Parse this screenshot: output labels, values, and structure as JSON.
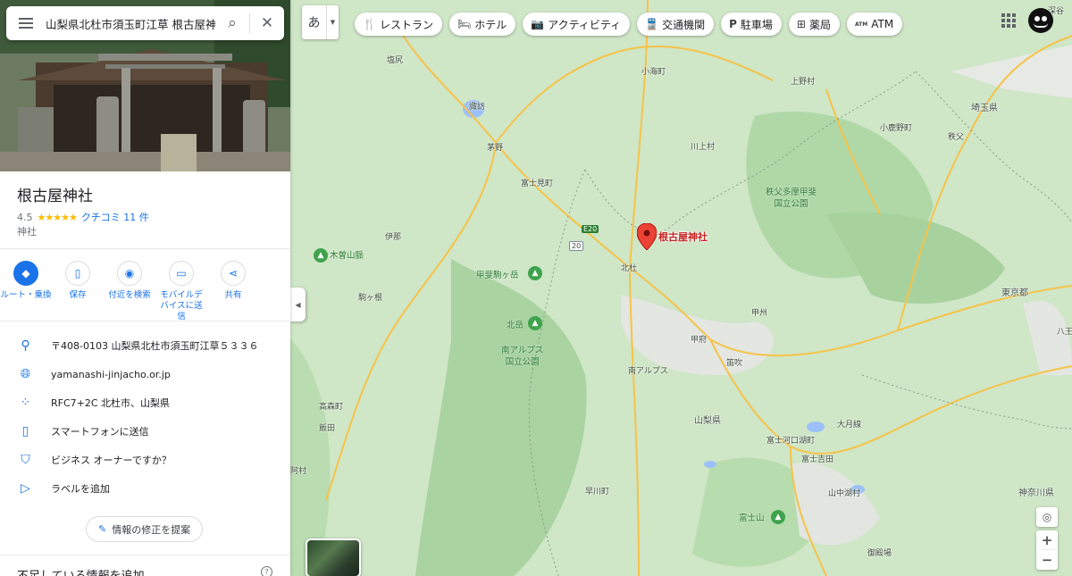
{
  "search": {
    "query": "山梨県北杜市須玉町江草 根古屋神社"
  },
  "place": {
    "name": "根古屋神社",
    "rating": "4.5",
    "stars": "★★★★★",
    "reviews": "クチコミ 11 件",
    "category": "神社"
  },
  "actions": [
    {
      "label": "ルート・乗換",
      "icon": "directions-icon"
    },
    {
      "label": "保存",
      "icon": "bookmark-icon"
    },
    {
      "label": "付近を検索",
      "icon": "nearby-icon"
    },
    {
      "label": "モバイルデバイスに送信",
      "icon": "send-to-phone-icon"
    },
    {
      "label": "共有",
      "icon": "share-icon"
    }
  ],
  "info": {
    "address": "〒408-0103 山梨県北杜市須玉町江草５３３６",
    "website": "yamanashi-jinjacho.or.jp",
    "pluscode": "RFC7+2C 北杜市、山梨県",
    "send": "スマートフォンに送信",
    "owner": "ビジネス オーナーですか？",
    "label": "ラベルを追加"
  },
  "suggest": "情報の修正を提案",
  "missing": "不足している情報を追加",
  "map": {
    "lang": "あ",
    "chips": [
      {
        "label": "レストラン",
        "icon": "restaurant-icon",
        "glyph": "🍴"
      },
      {
        "label": "ホテル",
        "icon": "hotel-icon",
        "glyph": "🛏"
      },
      {
        "label": "アクティビティ",
        "icon": "camera-icon",
        "glyph": "📷"
      },
      {
        "label": "交通機関",
        "icon": "transit-icon",
        "glyph": "🚆"
      },
      {
        "label": "駐車場",
        "icon": "parking-icon",
        "glyph": "P"
      },
      {
        "label": "薬局",
        "icon": "pharmacy-icon",
        "glyph": "⊞"
      },
      {
        "label": "ATM",
        "icon": "atm-icon",
        "glyph": "ATM"
      }
    ],
    "pin_label": "根古屋神社",
    "labels": [
      "塩尻",
      "諏訪",
      "茅野",
      "富士見町",
      "小海町",
      "川上村",
      "上野村",
      "埼玉県",
      "小鹿野町",
      "秩父",
      "深谷",
      "伊那",
      "北杜",
      "甲州",
      "甲府",
      "笛吹",
      "南アルプス",
      "高森町",
      "駒ヶ根",
      "飯田",
      "山梨県",
      "富士河口湖町",
      "富士吉田",
      "大月線",
      "山中湖村",
      "早川町",
      "御殿場",
      "神奈川県",
      "八王",
      "東京都",
      "阿村",
      "E20",
      "20"
    ],
    "parks": [
      "木曽山脈",
      "甲斐駒ヶ岳",
      "北岳",
      "南アルプス\n国立公園",
      "秩父多摩甲斐\n国立公園",
      "富士山"
    ],
    "colors": {
      "accent": "#1a73e8",
      "pin": "#ea4335",
      "park": "#3fa34d"
    }
  }
}
